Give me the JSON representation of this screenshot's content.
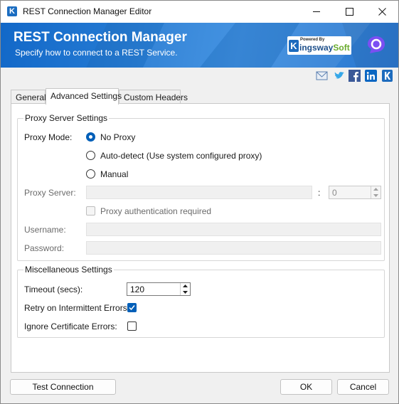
{
  "window": {
    "title": "REST Connection Manager Editor"
  },
  "banner": {
    "title": "REST Connection Manager",
    "subtitle": "Specify how to connect to a REST Service.",
    "logo_powered": "Powered By",
    "logo_k": "K",
    "logo_name": "ingsway",
    "logo_soft": "Soft"
  },
  "social": [
    "email-icon",
    "twitter-icon",
    "facebook-icon",
    "linkedin-icon",
    "kingswaysoft-icon"
  ],
  "tabs": [
    {
      "label": "General",
      "active": false
    },
    {
      "label": "Advanced Settings",
      "active": true
    },
    {
      "label": "Custom Headers",
      "active": false
    }
  ],
  "proxy": {
    "group_label": "Proxy Server Settings",
    "mode_label": "Proxy Mode:",
    "options": [
      {
        "label": "No Proxy",
        "checked": true
      },
      {
        "label": "Auto-detect (Use system configured proxy)",
        "checked": false
      },
      {
        "label": "Manual",
        "checked": false
      }
    ],
    "server_label": "Proxy Server:",
    "server_value": "",
    "port_separator": ":",
    "port_value": "0",
    "auth_label": "Proxy authentication required",
    "auth_checked": false,
    "username_label": "Username:",
    "username_value": "",
    "password_label": "Password:",
    "password_value": ""
  },
  "misc": {
    "group_label": "Miscellaneous Settings",
    "timeout_label": "Timeout (secs):",
    "timeout_value": "120",
    "retry_label": "Retry on Intermittent Errors:",
    "retry_checked": true,
    "ignore_cert_label": "Ignore Certificate Errors:",
    "ignore_cert_checked": false
  },
  "buttons": {
    "test_connection": "Test Connection",
    "ok": "OK",
    "cancel": "Cancel"
  },
  "colors": {
    "banner": "#1f74cf",
    "accent": "#005fb8",
    "logo_blue": "#1d6bbd",
    "logo_green": "#6aab2e"
  }
}
